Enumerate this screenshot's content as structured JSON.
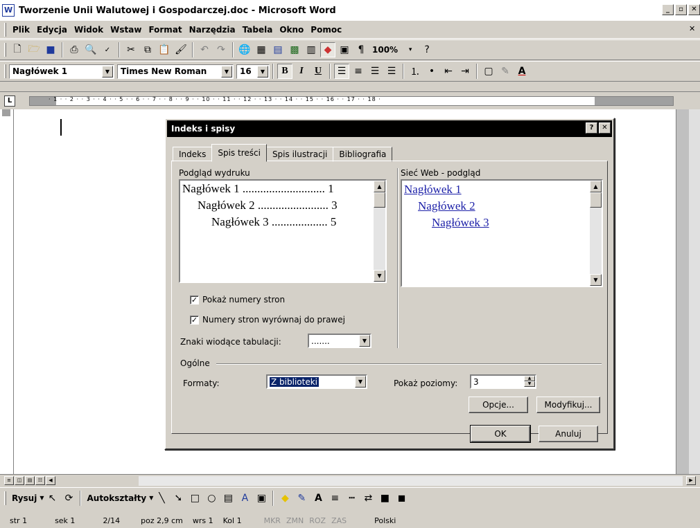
{
  "window": {
    "title": "Tworzenie Unii Walutowej i Gospodarczej.doc - Microsoft Word"
  },
  "menu": [
    "Plik",
    "Edycja",
    "Widok",
    "Wstaw",
    "Format",
    "Narzędzia",
    "Tabela",
    "Okno",
    "Pomoc"
  ],
  "standard_toolbar": {
    "zoom": "100%"
  },
  "format_toolbar": {
    "style": "Nagłówek 1",
    "font": "Times New Roman",
    "size": "16"
  },
  "ruler": {
    "numbers": "· 1 · · 2 · · 3 · · 4 · · 5 · · 6 · · 7 · · 8 · · 9 · · 10 · · 11 · · 12 · · 13 · · 14 · · 15 · · 16 · · 17 · · 18 ·"
  },
  "dialog": {
    "title": "Indeks i spisy",
    "tabs": [
      "Indeks",
      "Spis treści",
      "Spis ilustracji",
      "Bibliografia"
    ],
    "active_tab": "Spis treści",
    "print_preview_label": "Podgląd wydruku",
    "web_preview_label": "Sieć Web - podgląd",
    "print_preview": [
      {
        "text": "Nagłówek 1 ............................ 1"
      },
      {
        "text": "Nagłówek 2 ........................ 3"
      },
      {
        "text": "Nagłówek 3 ................... 5"
      }
    ],
    "web_preview": [
      "Nagłówek 1",
      "Nagłówek 2",
      "Nagłówek 3"
    ],
    "show_page_numbers": {
      "label": "Pokaż numery stron",
      "checked": true
    },
    "align_right": {
      "label": "Numery stron wyrównaj do prawej",
      "checked": true
    },
    "tab_leader": {
      "label": "Znaki wiodące tabulacji:",
      "value": "......."
    },
    "general_label": "Ogólne",
    "formats": {
      "label": "Formaty:",
      "value": "Z biblioteki"
    },
    "levels": {
      "label": "Pokaż poziomy:",
      "value": "3"
    },
    "options_button": "Opcje...",
    "modify_button": "Modyfikuj...",
    "ok_button": "OK",
    "cancel_button": "Anuluj"
  },
  "draw_toolbar": {
    "draw": "Rysuj",
    "autoshapes": "Autokształty"
  },
  "status": {
    "page": "str 1",
    "section": "sek 1",
    "pages": "2/14",
    "position": "poz 2,9 cm",
    "line": "wrs 1",
    "col": "Kol 1",
    "rec": "MKR",
    "trk": "ZMN",
    "ext": "ROZ",
    "ovr": "ZAS",
    "lang": "Polski"
  }
}
